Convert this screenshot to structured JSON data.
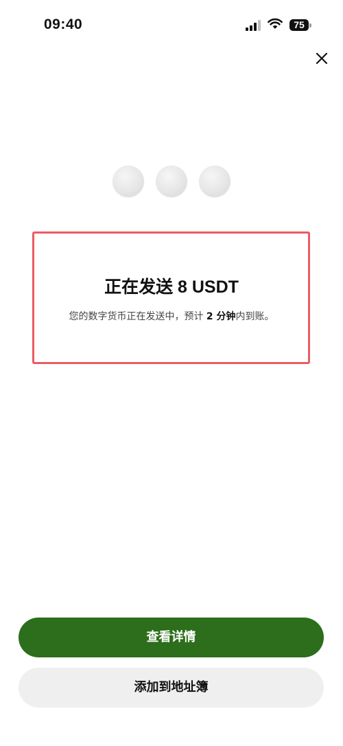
{
  "status_bar": {
    "time": "09:40",
    "battery": "75",
    "icons": [
      "signal-icon",
      "wifi-icon",
      "battery-icon"
    ]
  },
  "header": {
    "close_icon": "close-icon"
  },
  "loading": {
    "dot_count": 3
  },
  "message": {
    "title": "正在发送 8 USDT",
    "subtitle_prefix": "您的数字货币正在发送中，预计 ",
    "subtitle_emphasis": "2 分钟",
    "subtitle_suffix": "内到账。",
    "highlight_color": "#ec5a62"
  },
  "actions": {
    "primary_label": "查看详情",
    "secondary_label": "添加到地址簿",
    "primary_color": "#2c6e1b"
  }
}
